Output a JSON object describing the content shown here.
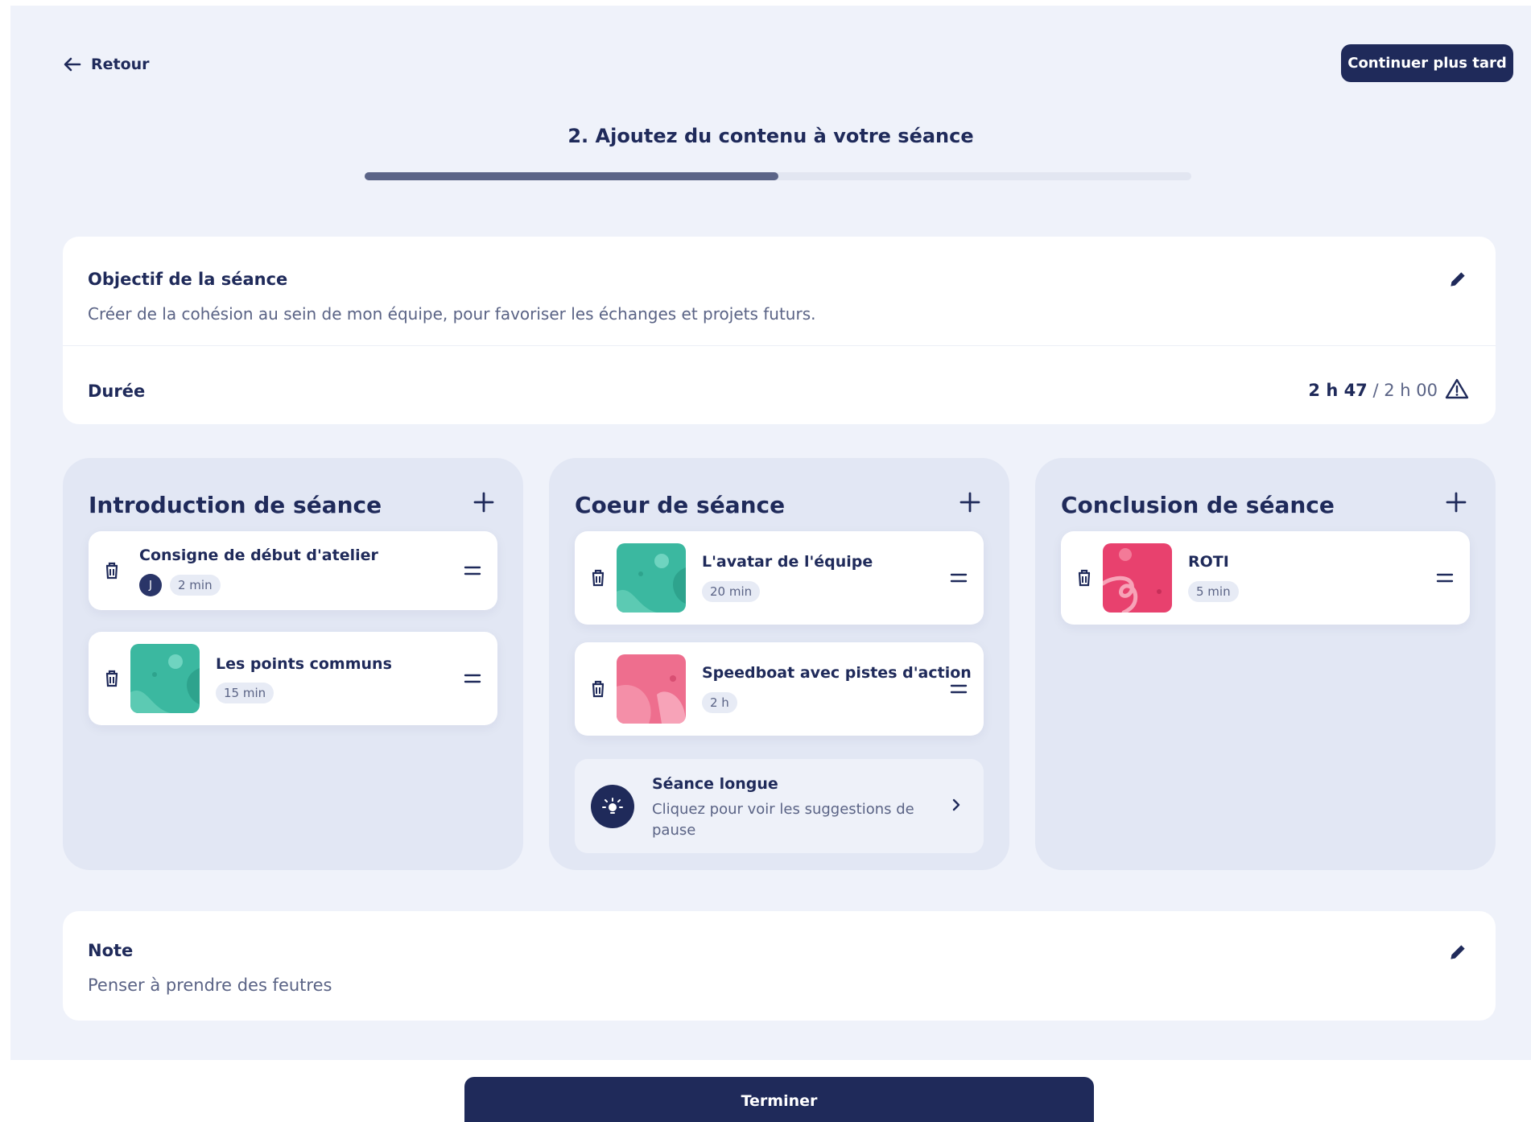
{
  "header": {
    "back_label": "Retour",
    "later_label": "Continuer plus tard",
    "step_title": "2. Ajoutez du contenu à votre séance",
    "progress": 0.5
  },
  "objective": {
    "title": "Objectif de la séance",
    "text": "Créer de la cohésion au sein de mon équipe, pour favoriser les échanges et projets futurs."
  },
  "duration": {
    "label": "Durée",
    "current": "2 h 47",
    "separator": " / ",
    "target": "2 h 00"
  },
  "columns": {
    "intro": {
      "title": "Introduction de séance",
      "items": [
        {
          "title": "Consigne de début d'atelier",
          "avatar": "J",
          "duration": "2 min"
        },
        {
          "title": "Les points communs",
          "duration": "15 min"
        }
      ]
    },
    "core": {
      "title": "Coeur de séance",
      "items": [
        {
          "title": "L'avatar de l'équipe",
          "duration": "20 min"
        },
        {
          "title": "Speedboat avec pistes d'action",
          "duration": "2 h"
        }
      ],
      "suggestion": {
        "title": "Séance longue",
        "text": "Cliquez pour voir les suggestions de pause"
      }
    },
    "conclusion": {
      "title": "Conclusion de séance",
      "items": [
        {
          "title": "ROTI",
          "duration": "5 min"
        }
      ]
    }
  },
  "note": {
    "title": "Note",
    "text": "Penser à prendre des feutres"
  },
  "footer": {
    "finish_label": "Terminer"
  },
  "colors": {
    "navy": "#1f2a5a",
    "background": "#eff2fa",
    "column_bg": "#e2e7f4",
    "thumb_teal": "#3bb8a0",
    "thumb_pink": "#ee6e8e",
    "thumb_red": "#e8416e"
  },
  "icons": [
    "arrow-left-icon",
    "pencil-icon",
    "warning-triangle-icon",
    "plus-icon",
    "trash-icon",
    "drag-handle-icon",
    "lightbulb-icon",
    "chevron-right-icon"
  ]
}
